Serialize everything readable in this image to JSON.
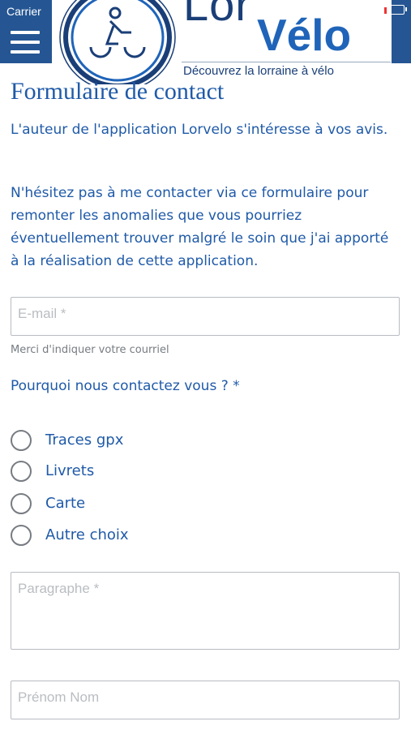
{
  "status_bar": {
    "carrier": "Carrier"
  },
  "brand": {
    "word1": "Lor",
    "word2": "Vélo",
    "tagline": "Découvrez la lorraine à vélo"
  },
  "page": {
    "title": "Formulaire de contact",
    "intro1": "L'auteur de l'application Lorvelo s'intéresse à vos avis.",
    "intro2": "N'hésitez pas à me contacter via ce formulaire pour remonter les anomalies que vous pourriez éventuellement trouver malgré le soin que j'ai apporté à la réalisation de cette application."
  },
  "form": {
    "email_placeholder": "E-mail *",
    "email_helper": "Merci d'indiquer votre courriel",
    "reason_question": "Pourquoi nous contactez vous ? *",
    "reasons": [
      "Traces gpx",
      "Livrets",
      "Carte",
      "Autre choix"
    ],
    "paragraph_placeholder": "Paragraphe *",
    "name_placeholder": "Prénom Nom"
  },
  "colors": {
    "header_blue": "#255693",
    "text_blue": "#1f5aa8",
    "brand_dark": "#1a3f78",
    "brand_accent": "#1f64b9"
  },
  "icons": [
    "hamburger-menu-icon",
    "battery-icon",
    "cyclist-logo-icon"
  ]
}
